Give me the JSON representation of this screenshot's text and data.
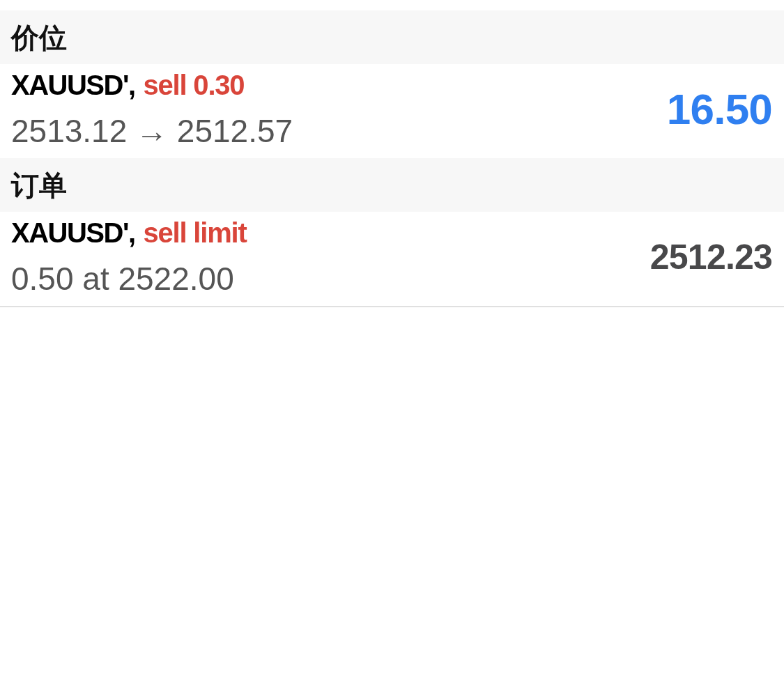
{
  "sections": [
    {
      "title": "价位",
      "items": [
        {
          "kind": "position",
          "symbol": "XAUUSD',",
          "action": "sell 0.30",
          "detail": "2513.12 → 2512.57",
          "value": "16.50"
        }
      ]
    },
    {
      "title": "订单",
      "items": [
        {
          "kind": "order",
          "symbol": "XAUUSD',",
          "action": "sell limit",
          "detail": "0.50 at 2522.00",
          "value": "2512.23"
        }
      ]
    }
  ]
}
